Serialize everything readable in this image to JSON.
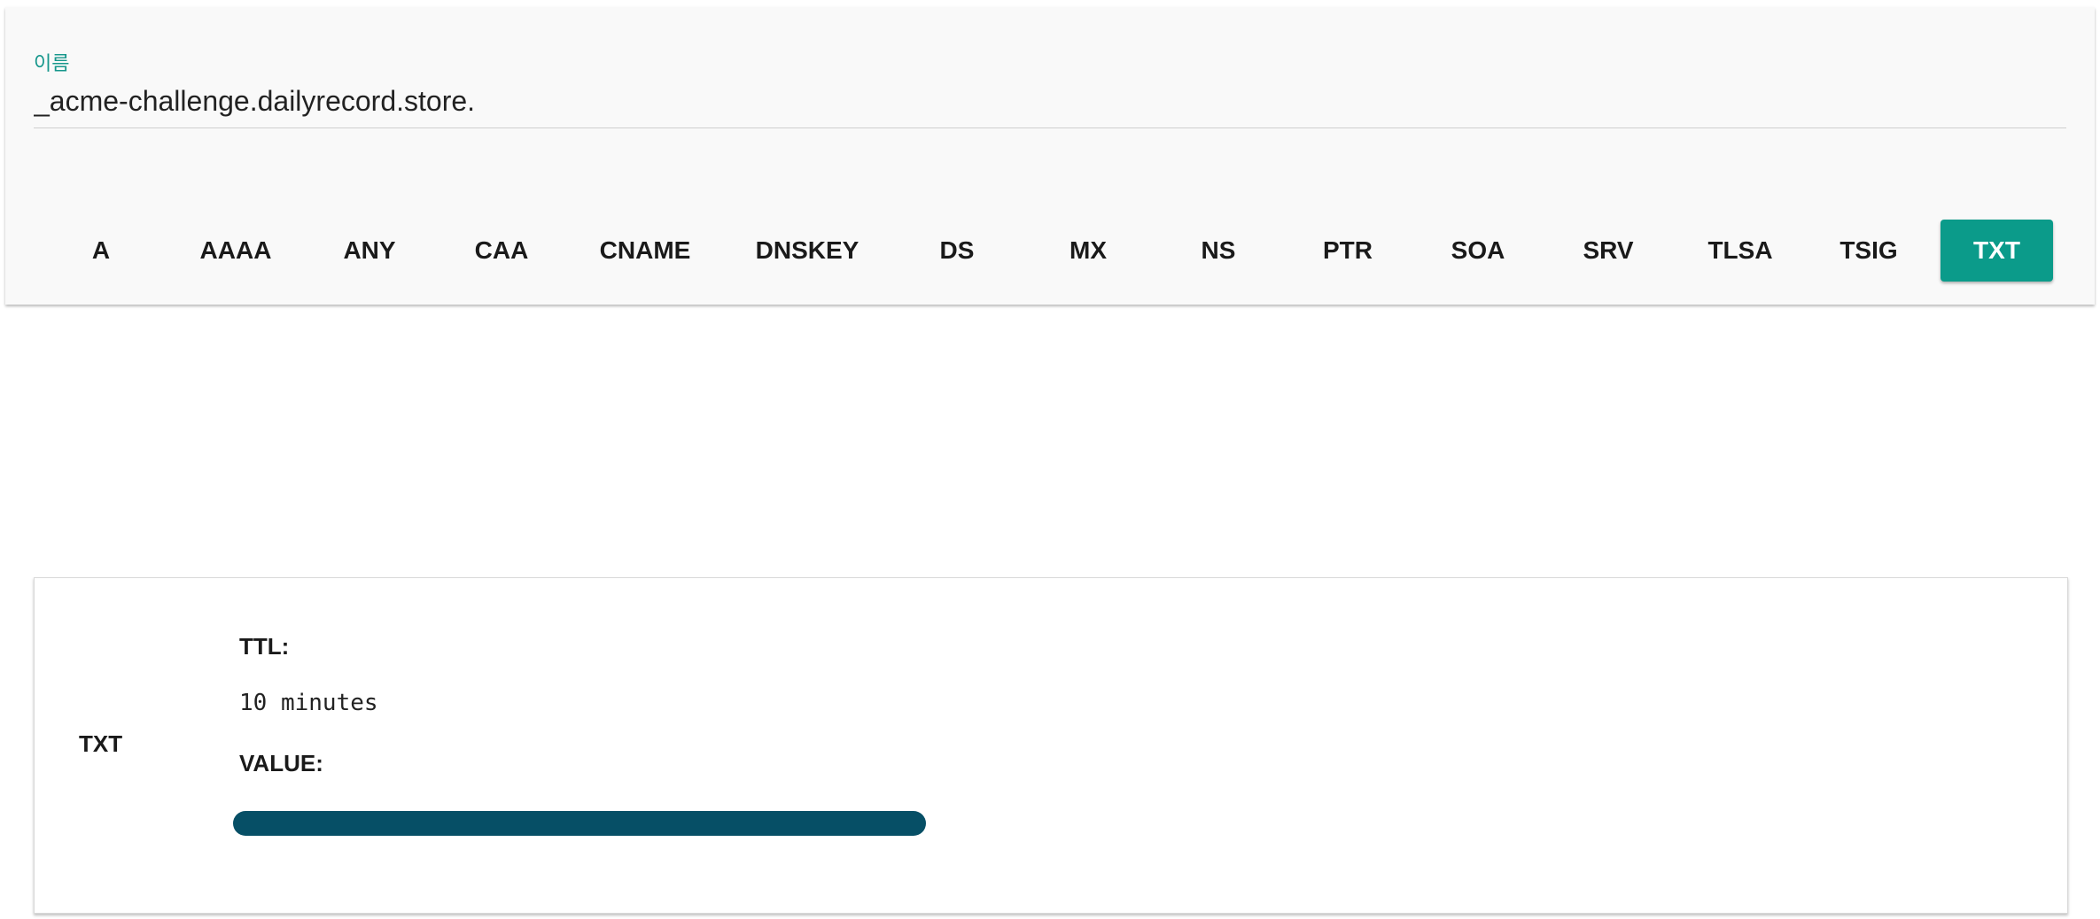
{
  "query": {
    "name_label": "이름",
    "name_value": "_acme-challenge.dailyrecord.store.",
    "record_types": [
      "A",
      "AAAA",
      "ANY",
      "CAA",
      "CNAME",
      "DNSKEY",
      "DS",
      "MX",
      "NS",
      "PTR",
      "SOA",
      "SRV",
      "TLSA",
      "TSIG",
      "TXT"
    ],
    "selected_type": "TXT",
    "accent_color": "#0b9b8a"
  },
  "result": {
    "record_type": "TXT",
    "ttl_label": "TTL:",
    "ttl_value": "10 minutes",
    "value_label": "VALUE:",
    "value_bar_color": "#064f66"
  }
}
